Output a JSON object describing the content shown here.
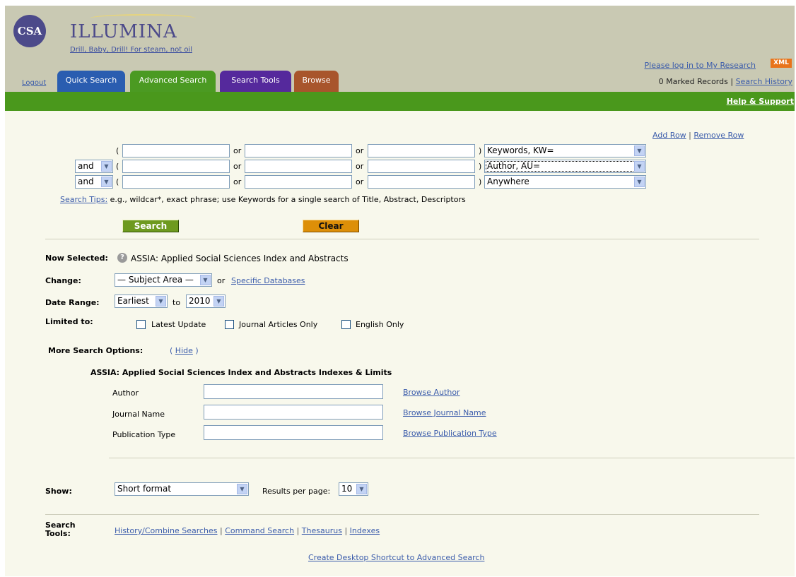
{
  "header": {
    "logo_text": "CSA",
    "title": "ILLUMINA",
    "tagline": "Drill, Baby, Drill! For steam, not oil",
    "login_link": "Please log in to My Research",
    "xml_badge": "XML",
    "marked_records": "0 Marked Records",
    "search_history": "Search History",
    "separator": "|",
    "logout": "Logout"
  },
  "tabs": [
    {
      "label": "Quick Search"
    },
    {
      "label": "Advanced Search"
    },
    {
      "label": "Search Tools"
    },
    {
      "label": "Browse"
    }
  ],
  "help_support": "Help & Support",
  "row_controls": {
    "add_row": "Add Row",
    "separator": "|",
    "remove_row": "Remove Row"
  },
  "search_rows": [
    {
      "operator": "",
      "open_paren": "(",
      "or1": "or",
      "or2": "or",
      "close_paren": ")",
      "field": "Keywords, KW="
    },
    {
      "operator": "and",
      "open_paren": "(",
      "or1": "or",
      "or2": "or",
      "close_paren": ")",
      "field": "Author, AU="
    },
    {
      "operator": "and",
      "open_paren": "(",
      "or1": "or",
      "or2": "or",
      "close_paren": ")",
      "field": "Anywhere"
    }
  ],
  "search_tips": {
    "link": "Search Tips:",
    "text": "e.g., wildcar*, exact phrase; use Keywords for a single search of Title, Abstract, Descriptors"
  },
  "buttons": {
    "search": "Search",
    "clear": "Clear"
  },
  "now_selected": {
    "label": "Now Selected:",
    "help_icon": "?",
    "value": "ASSIA: Applied Social Sciences Index and Abstracts"
  },
  "change": {
    "label": "Change:",
    "subject_select": "— Subject Area —",
    "or": "or",
    "specific_link": "Specific Databases"
  },
  "date_range": {
    "label": "Date Range:",
    "from": "Earliest",
    "to_label": "to",
    "to": "2010"
  },
  "limited_to": {
    "label": "Limited to:",
    "options": [
      {
        "label": "Latest Update",
        "checked": false
      },
      {
        "label": "Journal Articles Only",
        "checked": false
      },
      {
        "label": "English Only",
        "checked": false
      }
    ]
  },
  "more_options": {
    "label": "More Search Options:",
    "open_paren": "(",
    "hide_link": "Hide",
    "close_paren": ")"
  },
  "indexes": {
    "title": "ASSIA: Applied Social Sciences Index and Abstracts Indexes & Limits",
    "fields": [
      {
        "label": "Author",
        "value": "",
        "browse": "Browse Author"
      },
      {
        "label": "Journal Name",
        "value": "",
        "browse": "Browse Journal Name"
      },
      {
        "label": "Publication Type",
        "value": "",
        "browse": "Browse Publication Type"
      }
    ]
  },
  "show": {
    "label": "Show:",
    "format": "Short format",
    "results_label": "Results per page:",
    "results": "10"
  },
  "search_tools": {
    "label_line1": "Search",
    "label_line2": "Tools:",
    "links": [
      "History/Combine Searches",
      "Command Search",
      "Thesaurus",
      "Indexes"
    ],
    "separator": "|"
  },
  "desktop_shortcut": "Create Desktop Shortcut to Advanced Search",
  "colors": {
    "green_bar": "#4a981c",
    "header_bg": "#c9c9b3",
    "page_bg": "#f8f8ec",
    "link": "#3b5cab",
    "quick_tab": "#2a5db0",
    "advanced_tab": "#4b9a22",
    "tools_tab": "#55299c",
    "browse_tab": "#a8552c",
    "search_button": "#6e9a1f",
    "clear_button": "#dd8f08",
    "xml_badge": "#e8741b"
  },
  "icons": {
    "dropdown": "chevron-down-icon",
    "help": "question-icon"
  }
}
